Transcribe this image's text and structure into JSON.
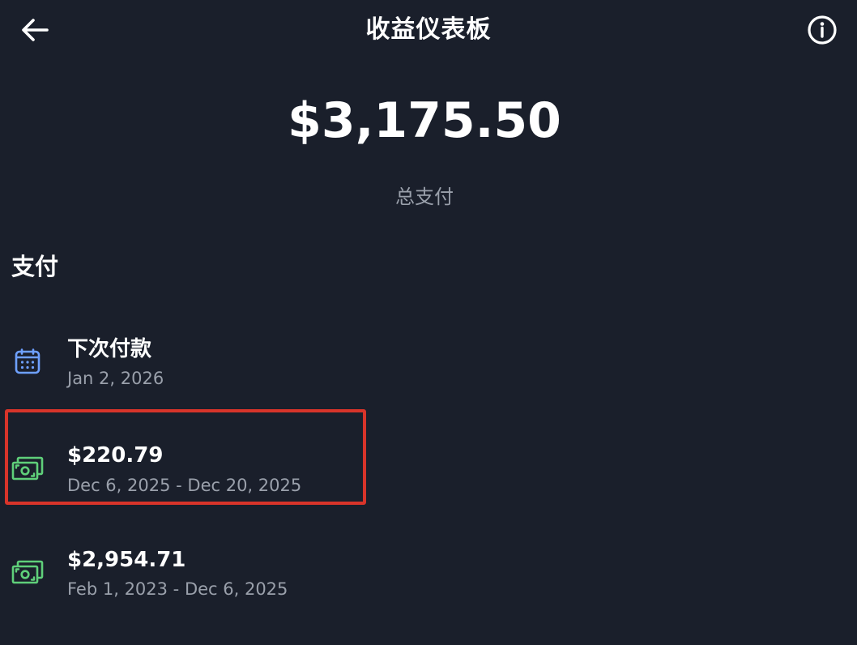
{
  "header": {
    "title": "收益仪表板",
    "back_icon": "arrow-left-icon",
    "info_icon": "info-icon"
  },
  "summary": {
    "total_amount": "$3,175.50",
    "total_label": "总支付"
  },
  "payments": {
    "section_title": "支付",
    "next_payment": {
      "icon": "calendar-icon",
      "title": "下次付款",
      "date": "Jan 2, 2026"
    },
    "items": [
      {
        "icon": "cash-icon",
        "amount": "$220.79",
        "period": "Dec 6, 2025 - Dec 20, 2025",
        "highlighted": true
      },
      {
        "icon": "cash-icon",
        "amount": "$2,954.71",
        "period": "Feb 1, 2023 - Dec 6, 2025",
        "highlighted": false
      }
    ]
  },
  "colors": {
    "background": "#1a1f2b",
    "primary_text": "#ffffff",
    "secondary_text": "#9aa0ab",
    "calendar_icon": "#6ea0ff",
    "cash_icon": "#5fcf7a",
    "highlight_border": "#d8342a"
  }
}
